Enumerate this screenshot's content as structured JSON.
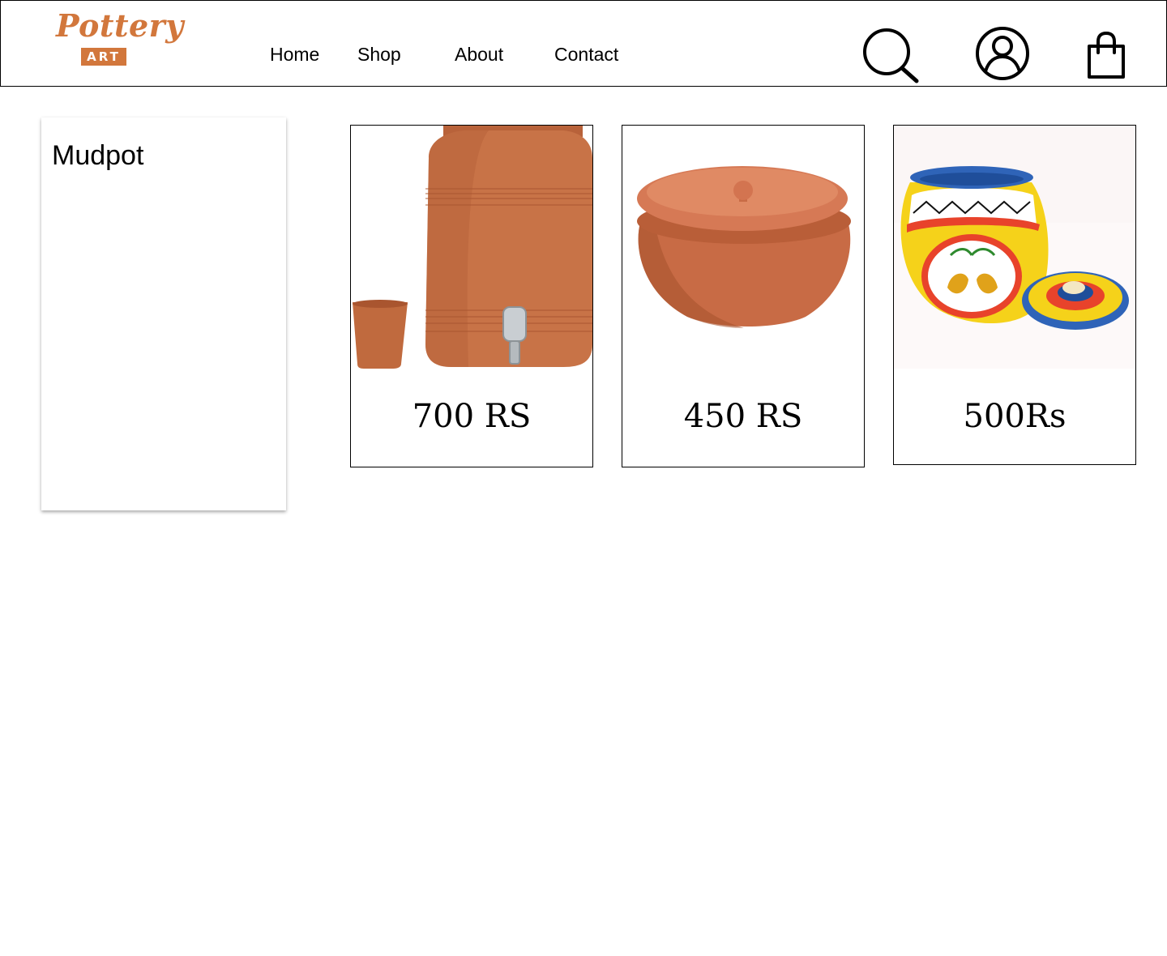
{
  "header": {
    "logo": {
      "word": "Pottery",
      "badge": "ART"
    },
    "nav": [
      {
        "label": "Home"
      },
      {
        "label": "Shop"
      },
      {
        "label": "About"
      },
      {
        "label": "Contact"
      }
    ],
    "icons": [
      "search-icon",
      "account-icon",
      "shopping-bag-icon"
    ]
  },
  "sidebar": {
    "title": "Mudpot"
  },
  "products": [
    {
      "image": "clay-water-dispenser-with-cup",
      "price": "700 RS"
    },
    {
      "image": "clay-handi-pot-with-lid",
      "price": "450 RS"
    },
    {
      "image": "painted-madhubani-pot-with-lid",
      "price": "500Rs"
    }
  ],
  "colors": {
    "brand": "#d2773c",
    "clay": "#c87347",
    "border": "#000000"
  }
}
